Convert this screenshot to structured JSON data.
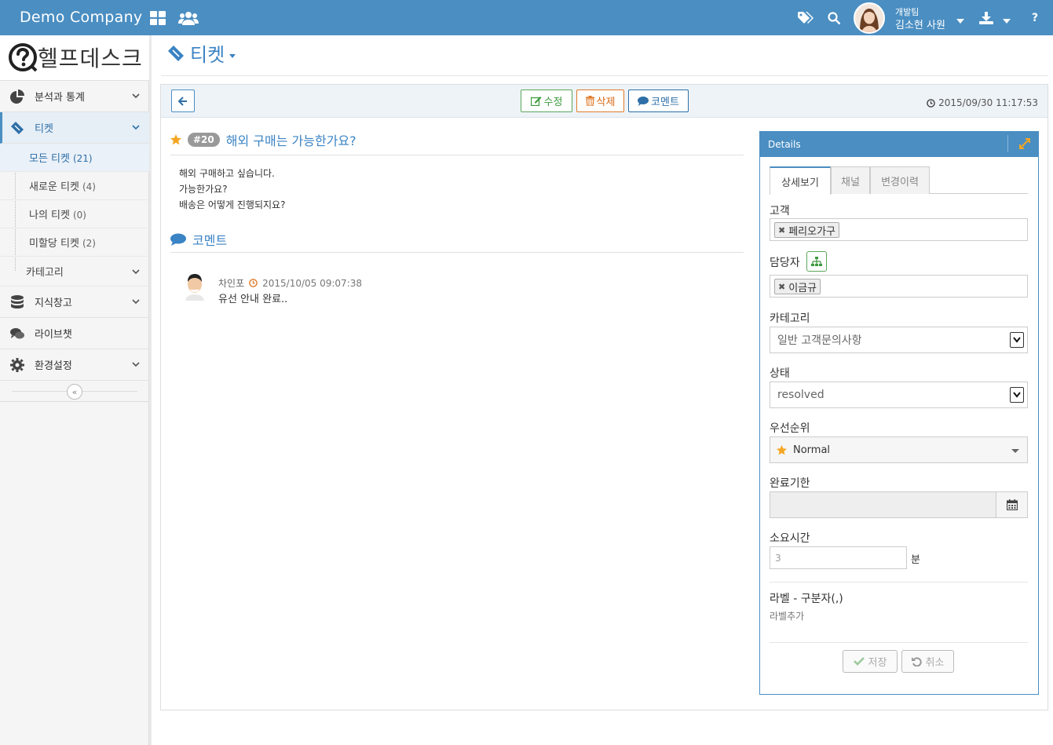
{
  "topbar": {
    "brand": "Demo Company",
    "user_team": "개발팀",
    "user_name": "김소현 사원"
  },
  "sidebar": {
    "logo_text": "헬프데스크",
    "items": [
      {
        "label": "분석과 통계",
        "icon": "pie-chart-icon"
      },
      {
        "label": "티켓",
        "icon": "ticket-icon",
        "active": true
      },
      {
        "label": "지식창고",
        "icon": "database-icon"
      },
      {
        "label": "라이브챗",
        "icon": "chat-icon"
      },
      {
        "label": "환경설정",
        "icon": "gear-icon"
      }
    ],
    "ticket_sub": [
      {
        "label": "모든 티켓",
        "count": "(21)"
      },
      {
        "label": "새로운 티켓",
        "count": "(4)"
      },
      {
        "label": "나의 티켓",
        "count": "(0)"
      },
      {
        "label": "미할당 티켓",
        "count": "(2)"
      }
    ],
    "category_label": "카테고리"
  },
  "page": {
    "title": "티켓"
  },
  "toolbar": {
    "edit_label": "수정",
    "delete_label": "삭제",
    "comment_label": "코멘트",
    "timestamp": "2015/09/30 11:17:53"
  },
  "ticket": {
    "number": "#20",
    "subject": "해외 구매는 가능한가요?",
    "body_lines": [
      "해외 구매하고 싶습니다.",
      "가능한가요?",
      "배송은 어떻게 진행되지요?"
    ],
    "comments_heading": "코멘트",
    "comment": {
      "author": "차인포",
      "date": "2015/10/05 09:07:38",
      "text": "유선 안내 완료.."
    }
  },
  "details": {
    "heading": "Details",
    "tabs": [
      "상세보기",
      "채널",
      "변경이력"
    ],
    "customer_label": "고객",
    "customer_value": "페리오가구",
    "assignee_label": "담당자",
    "assignee_value": "이금규",
    "category_label": "카테고리",
    "category_value": "일반 고객문의사항",
    "status_label": "상태",
    "status_value": "resolved",
    "priority_label": "우선순위",
    "priority_value": "Normal",
    "due_label": "완료기한",
    "due_value": "",
    "time_label": "소요시간",
    "time_value": "3",
    "time_unit": "분",
    "labels_label": "라벨 - 구분자(,)",
    "labels_add": "라벨추가",
    "save_label": "저장",
    "cancel_label": "취소"
  },
  "colors": {
    "topbar": "#4a8ec2",
    "accent": "#3a83c4",
    "edit": "#3d9a3d",
    "delete": "#e07b2a",
    "comment": "#2e6fa7",
    "star": "#f5a623"
  }
}
